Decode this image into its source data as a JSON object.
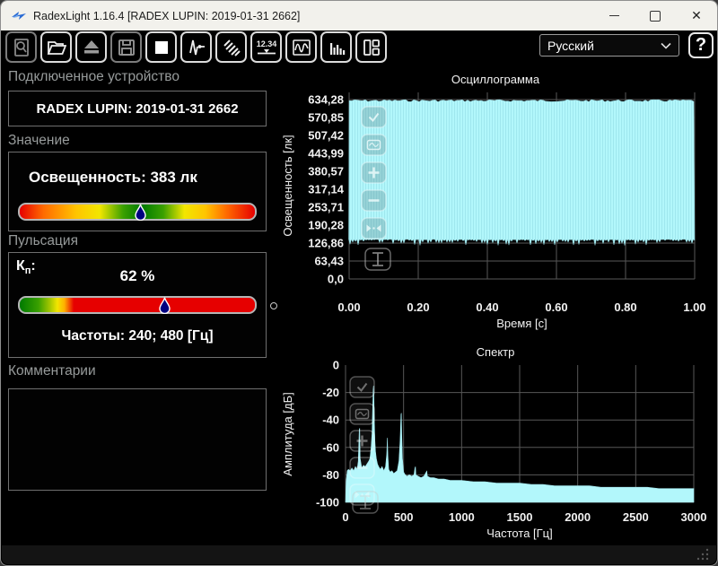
{
  "window": {
    "title": "RadexLight 1.16.4 [RADEX LUPIN: 2019-01-31 2662]"
  },
  "toolbar": {
    "numeric_icon_label": "12.34",
    "language_value": "Русский",
    "help_label": "?"
  },
  "device_section": {
    "header": "Подключенное устройство",
    "device": "RADEX LUPIN: 2019-01-31 2662"
  },
  "value_section": {
    "header": "Значение",
    "reading": "Освещенность: 383 лк",
    "marker_percent": 51,
    "gradient_stops": [
      [
        "#e60000",
        0
      ],
      [
        "#ff6a00",
        10
      ],
      [
        "#ffc400",
        24
      ],
      [
        "#f2e600",
        34
      ],
      [
        "#3aa000",
        44
      ],
      [
        "#007a00",
        52
      ],
      [
        "#3aa000",
        61
      ],
      [
        "#f2e600",
        70
      ],
      [
        "#ffc400",
        79
      ],
      [
        "#ff6a00",
        88
      ],
      [
        "#e60000",
        100
      ]
    ]
  },
  "pulsation_section": {
    "header": "Пульсация",
    "kp_letter": "К",
    "kp_sub": "п",
    "kp_colon": ":",
    "value": "62 %",
    "marker_percent": 61.5,
    "frequencies": "Частоты: 240; 480 [Гц]",
    "gradient_stops": [
      [
        "#007a00",
        0
      ],
      [
        "#3aa000",
        8
      ],
      [
        "#a8c800",
        13
      ],
      [
        "#f2e600",
        16
      ],
      [
        "#ffb000",
        19
      ],
      [
        "#e60000",
        23
      ],
      [
        "#e60000",
        100
      ]
    ]
  },
  "comments_section": {
    "header": "Комментарии",
    "text": ""
  },
  "theme": {
    "plot_fill": "#b2f7fb",
    "plot_fill_stripe": "#9fe7ee",
    "grid_color": "#575757",
    "tick_color": "#f2f2f2",
    "status_green": "#007a00",
    "status_red": "#e60000",
    "status_yellow": "#f2e600"
  },
  "chart_data": [
    {
      "type": "area",
      "name": "oscillogram",
      "title": "Осциллограмма",
      "xlabel": "Время [с]",
      "ylabel": "Освещенность [лк]",
      "x_ticks": [
        "0.00",
        "0.20",
        "0.40",
        "0.60",
        "0.80",
        "1.00"
      ],
      "y_ticks": [
        "634,28",
        "570,85",
        "507,42",
        "443,99",
        "380,57",
        "317,14",
        "253,71",
        "190,28",
        "126,86",
        "63,43",
        "0,0"
      ],
      "xlim": [
        0,
        1
      ],
      "ylim": [
        0,
        634.28
      ],
      "envelope": {
        "y_max": 634.28,
        "y_min_base": 140,
        "y_min_spikes": 118
      },
      "grid": true
    },
    {
      "type": "area",
      "name": "spectrum",
      "title": "Спектр",
      "xlabel": "Частота [Гц]",
      "ylabel": "Амплитуда [дБ]",
      "x_ticks": [
        "0",
        "500",
        "1000",
        "1500",
        "2000",
        "2500",
        "3000"
      ],
      "y_ticks": [
        "0",
        "-20",
        "-40",
        "-60",
        "-80",
        "-100"
      ],
      "xlim": [
        0,
        3000
      ],
      "ylim": [
        -100,
        0
      ],
      "grid": true,
      "points": [
        [
          0,
          -100
        ],
        [
          5,
          -85
        ],
        [
          15,
          -77
        ],
        [
          25,
          -76
        ],
        [
          40,
          -77
        ],
        [
          55,
          -75
        ],
        [
          70,
          -77
        ],
        [
          85,
          -74
        ],
        [
          100,
          -76
        ],
        [
          110,
          -70
        ],
        [
          118,
          -47
        ],
        [
          122,
          -46
        ],
        [
          126,
          -68
        ],
        [
          140,
          -75
        ],
        [
          155,
          -73
        ],
        [
          170,
          -74
        ],
        [
          185,
          -72
        ],
        [
          200,
          -70
        ],
        [
          210,
          -68
        ],
        [
          220,
          -60
        ],
        [
          228,
          -50
        ],
        [
          233,
          -35
        ],
        [
          238,
          -18
        ],
        [
          241,
          -15
        ],
        [
          244,
          -22
        ],
        [
          248,
          -40
        ],
        [
          253,
          -55
        ],
        [
          258,
          -63
        ],
        [
          265,
          -68
        ],
        [
          275,
          -72
        ],
        [
          285,
          -74
        ],
        [
          300,
          -76
        ],
        [
          315,
          -74
        ],
        [
          330,
          -77
        ],
        [
          345,
          -74
        ],
        [
          355,
          -65
        ],
        [
          360,
          -53
        ],
        [
          365,
          -66
        ],
        [
          372,
          -76
        ],
        [
          385,
          -78
        ],
        [
          400,
          -77
        ],
        [
          415,
          -79
        ],
        [
          430,
          -78
        ],
        [
          445,
          -77
        ],
        [
          460,
          -70
        ],
        [
          470,
          -55
        ],
        [
          478,
          -36
        ],
        [
          481,
          -35
        ],
        [
          484,
          -50
        ],
        [
          490,
          -68
        ],
        [
          500,
          -78
        ],
        [
          515,
          -80
        ],
        [
          530,
          -81
        ],
        [
          550,
          -80
        ],
        [
          570,
          -81
        ],
        [
          590,
          -80
        ],
        [
          598,
          -75
        ],
        [
          602,
          -74
        ],
        [
          606,
          -80
        ],
        [
          625,
          -81
        ],
        [
          650,
          -82
        ],
        [
          675,
          -81
        ],
        [
          695,
          -78
        ],
        [
          700,
          -77
        ],
        [
          705,
          -81
        ],
        [
          730,
          -82
        ],
        [
          760,
          -82
        ],
        [
          800,
          -83
        ],
        [
          850,
          -83
        ],
        [
          900,
          -84
        ],
        [
          950,
          -84
        ],
        [
          1000,
          -84
        ],
        [
          1100,
          -85
        ],
        [
          1200,
          -85
        ],
        [
          1300,
          -86
        ],
        [
          1400,
          -86
        ],
        [
          1500,
          -86
        ],
        [
          1600,
          -87
        ],
        [
          1700,
          -87
        ],
        [
          1800,
          -88
        ],
        [
          1900,
          -88
        ],
        [
          2000,
          -88
        ],
        [
          2100,
          -88
        ],
        [
          2200,
          -89
        ],
        [
          2300,
          -89
        ],
        [
          2400,
          -89
        ],
        [
          2500,
          -89
        ],
        [
          2600,
          -89
        ],
        [
          2700,
          -90
        ],
        [
          2800,
          -90
        ],
        [
          2900,
          -90
        ],
        [
          3000,
          -90
        ]
      ]
    }
  ]
}
